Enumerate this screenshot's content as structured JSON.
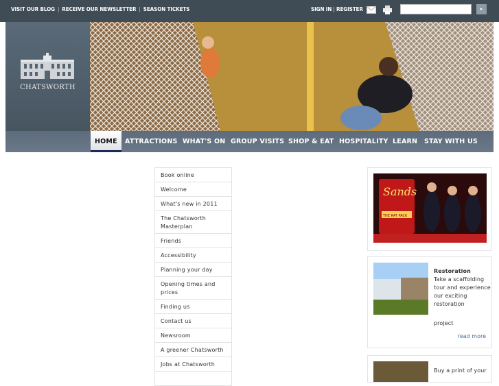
{
  "topbar": {
    "links": [
      "VISIT OUR BLOG",
      "RECEIVE OUR NEWSLETTER",
      "SEASON TICKETS"
    ],
    "sign_in": "SIGN IN",
    "register": "REGISTER",
    "search_placeholder": "",
    "search_button": "▸"
  },
  "logo": {
    "text": "CHATSWORTH"
  },
  "nav": [
    "HOME",
    "ATTRACTIONS",
    "WHAT'S ON",
    "GROUP VISITS",
    "SHOP & EAT",
    "HOSPITALITY",
    "LEARN",
    "STAY WITH US"
  ],
  "active_nav": "HOME",
  "menu": [
    "Book online",
    "Welcome",
    "What's new in 2011",
    "The Chatsworth Masterplan",
    "Friends",
    "Accessibility",
    "Planning your day",
    "Opening times and prices",
    "Finding us",
    "Contact us",
    "Newsroom",
    "A greener Chatsworth",
    "Jobs at Chatsworth"
  ],
  "promo": {
    "banner_text": "Sands",
    "banner_sub": "THE RAT PACK"
  },
  "restoration": {
    "title": "Restoration",
    "body": "Take a scaffolding tour and experience our exciting restoration",
    "body2": "project",
    "link": "read more"
  },
  "print": {
    "body": "Buy a print of your"
  }
}
